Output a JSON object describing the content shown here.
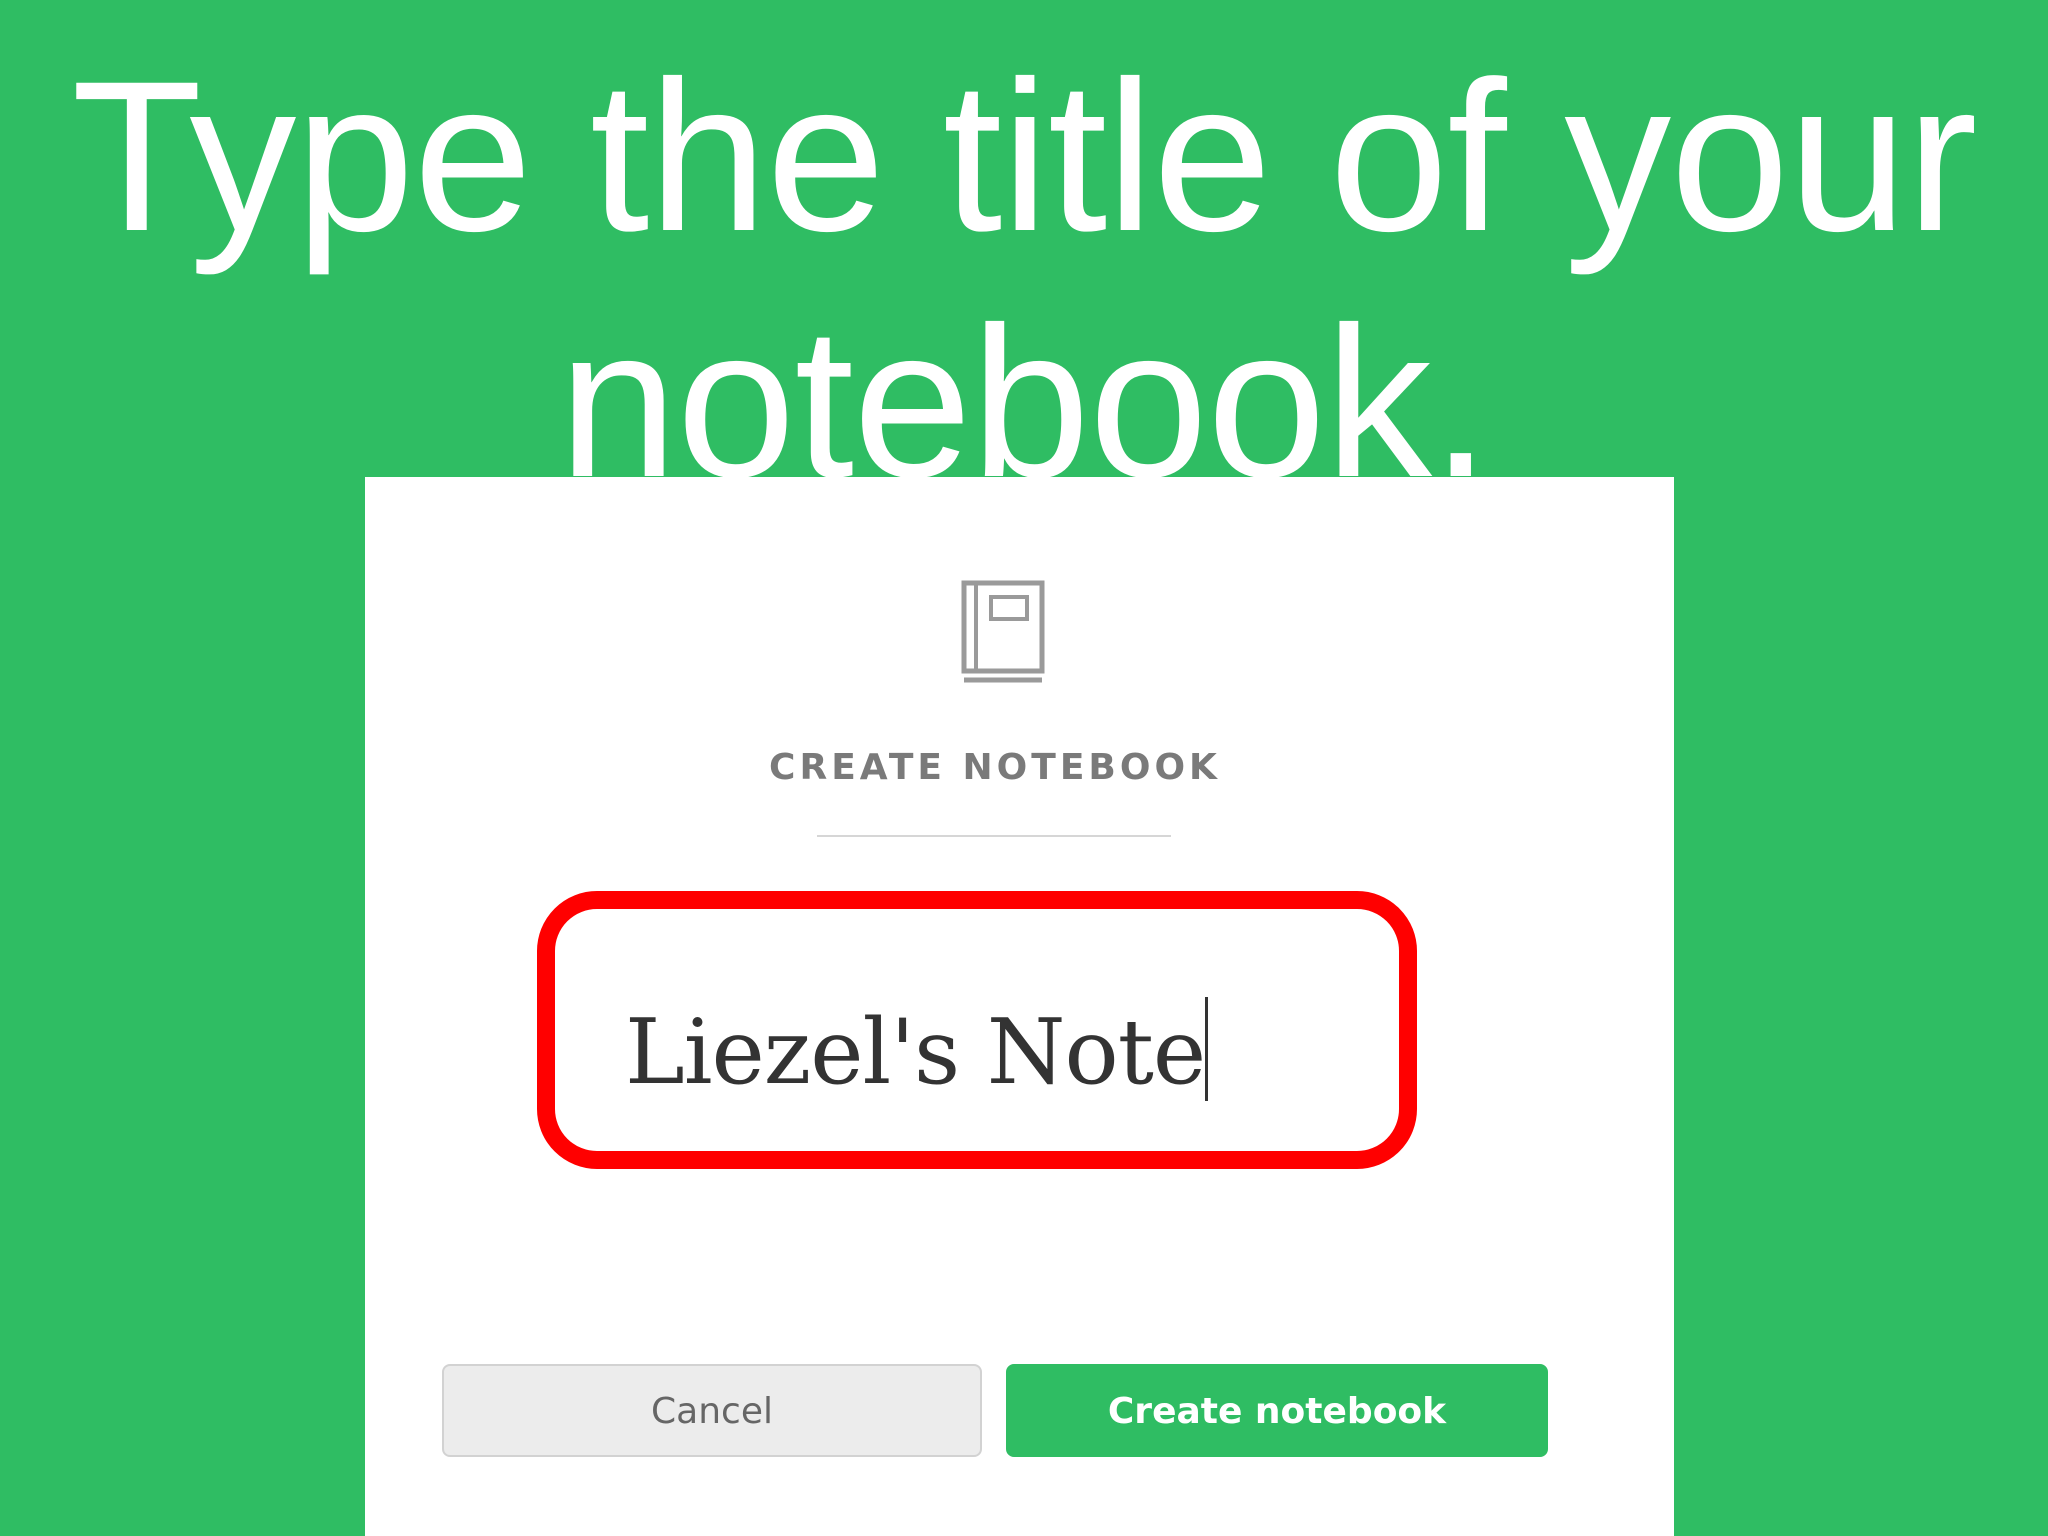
{
  "slide": {
    "title": "Type the title of your notebook."
  },
  "dialog": {
    "icon": "notebook-icon",
    "heading": "CREATE NOTEBOOK",
    "title_input": {
      "value": "Liezel's Note"
    },
    "cancel_label": "Cancel",
    "create_label": "Create notebook"
  },
  "colors": {
    "background": "#2fbd63",
    "accent": "#2fbd63",
    "highlight": "#ff0000"
  }
}
